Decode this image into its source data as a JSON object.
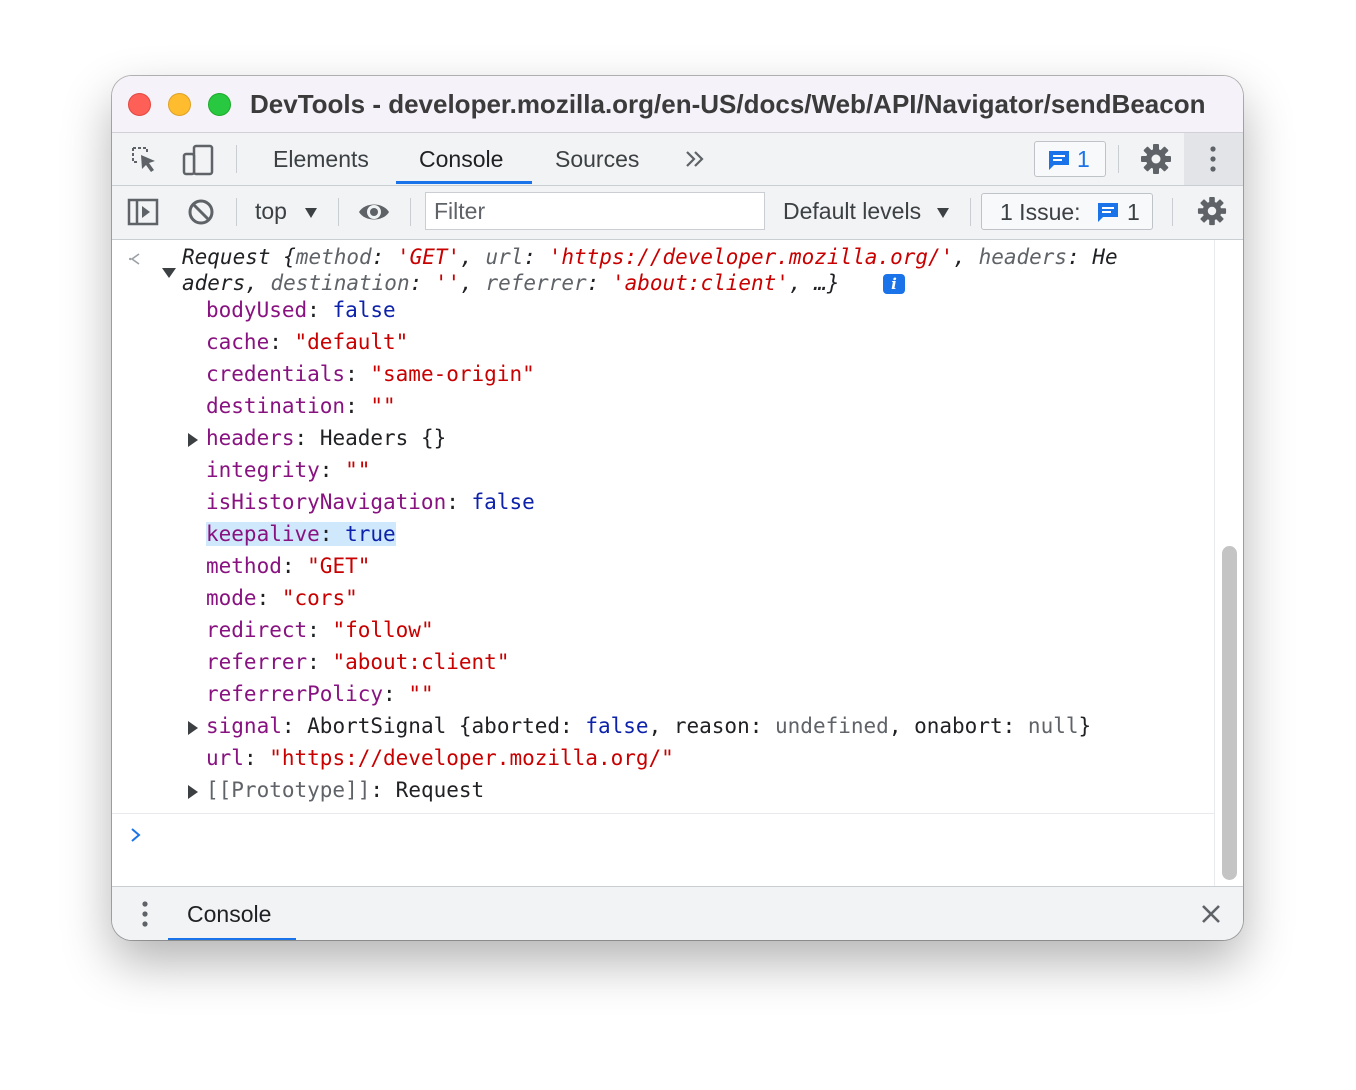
{
  "window": {
    "title": "DevTools - developer.mozilla.org/en-US/docs/Web/API/Navigator/sendBeacon"
  },
  "tabs": {
    "items": [
      "Elements",
      "Console",
      "Sources"
    ],
    "active": "Console",
    "more_icon": "double-chevron-right-icon",
    "messages_count": "1"
  },
  "toolbar": {
    "context": "top",
    "filter_placeholder": "Filter",
    "levels": "Default levels",
    "issues_label": "1 Issue:",
    "issues_count": "1"
  },
  "console": {
    "summary": {
      "line1_prefix": "Request {",
      "k_method": "method",
      "v_method": "'GET'",
      "k_url": "url",
      "v_url": "'https://developer.mozilla.org/'",
      "k_headers": "headers",
      "v_headers_a": "He",
      "v_headers_b": "aders",
      "k_destination": "destination",
      "v_destination": "''",
      "k_referrer": "referrer",
      "v_referrer": "'about:client'",
      "ellipsis": "…}"
    },
    "props": [
      {
        "key": "bodyUsed",
        "value": "false",
        "kind": "kw"
      },
      {
        "key": "cache",
        "value": "\"default\"",
        "kind": "str"
      },
      {
        "key": "credentials",
        "value": "\"same-origin\"",
        "kind": "str"
      },
      {
        "key": "destination",
        "value": "\"\"",
        "kind": "str"
      },
      {
        "key": "headers",
        "value": "Headers {}",
        "kind": "obj"
      },
      {
        "key": "integrity",
        "value": "\"\"",
        "kind": "str"
      },
      {
        "key": "isHistoryNavigation",
        "value": "false",
        "kind": "kw"
      },
      {
        "key": "keepalive",
        "value": "true",
        "kind": "kw"
      },
      {
        "key": "method",
        "value": "\"GET\"",
        "kind": "str"
      },
      {
        "key": "mode",
        "value": "\"cors\"",
        "kind": "str"
      },
      {
        "key": "redirect",
        "value": "\"follow\"",
        "kind": "str"
      },
      {
        "key": "referrer",
        "value": "\"about:client\"",
        "kind": "str"
      },
      {
        "key": "referrerPolicy",
        "value": "\"\"",
        "kind": "str"
      },
      {
        "key": "signal",
        "value": "AbortSignal"
      },
      {
        "key": "url",
        "value": "\"https://developer.mozilla.org/\"",
        "kind": "str"
      },
      {
        "key": "[[Prototype]]",
        "value": "Request"
      }
    ],
    "signal": {
      "k_aborted": "aborted",
      "v_aborted": "false",
      "k_reason": "reason",
      "v_reason": "undefined",
      "k_onabort": "onabort",
      "v_onabort": "null"
    }
  },
  "drawer": {
    "tab": "Console"
  },
  "colors": {
    "accent": "#1a73e8",
    "key": "#881280",
    "string": "#c80000",
    "keyword": "#0d22aa",
    "highlight": "#cfe8fc"
  }
}
